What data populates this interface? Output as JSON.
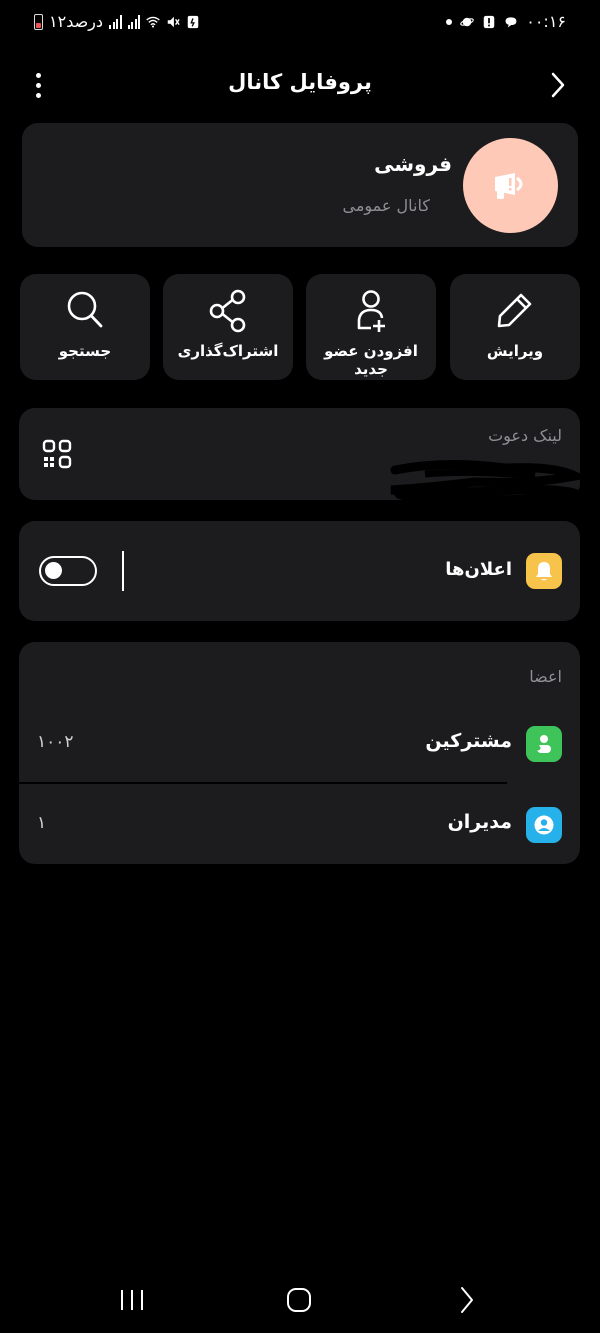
{
  "status_bar": {
    "time": "۰۰:۱۶",
    "battery_text": "۱۲درصد"
  },
  "header": {
    "title": "پروفایل کانال"
  },
  "profile": {
    "name": "فروشی",
    "type": "کانال عمومی"
  },
  "actions": [
    {
      "label": "ویرایش",
      "icon": "pencil-icon"
    },
    {
      "label": "افزودن عضو جدید",
      "icon": "add-user-icon"
    },
    {
      "label": "اشتراک‌گذاری",
      "icon": "share-icon"
    },
    {
      "label": "جستجو",
      "icon": "search-icon"
    }
  ],
  "invite": {
    "label": "لینک دعوت"
  },
  "notifications": {
    "label": "اعلان‌ها",
    "enabled": false
  },
  "members": {
    "title": "اعضا",
    "rows": [
      {
        "label": "مشترکین",
        "count": "۱۰۰۲",
        "icon": "subscribers-icon",
        "color": "#3fc45a"
      },
      {
        "label": "مدیران",
        "count": "۱",
        "icon": "admins-icon",
        "color": "#27b1ea"
      }
    ]
  },
  "colors": {
    "card_bg": "#1c1c1e",
    "avatar_bg": "#ffc9b8",
    "bell_bg": "#f7c34a"
  }
}
